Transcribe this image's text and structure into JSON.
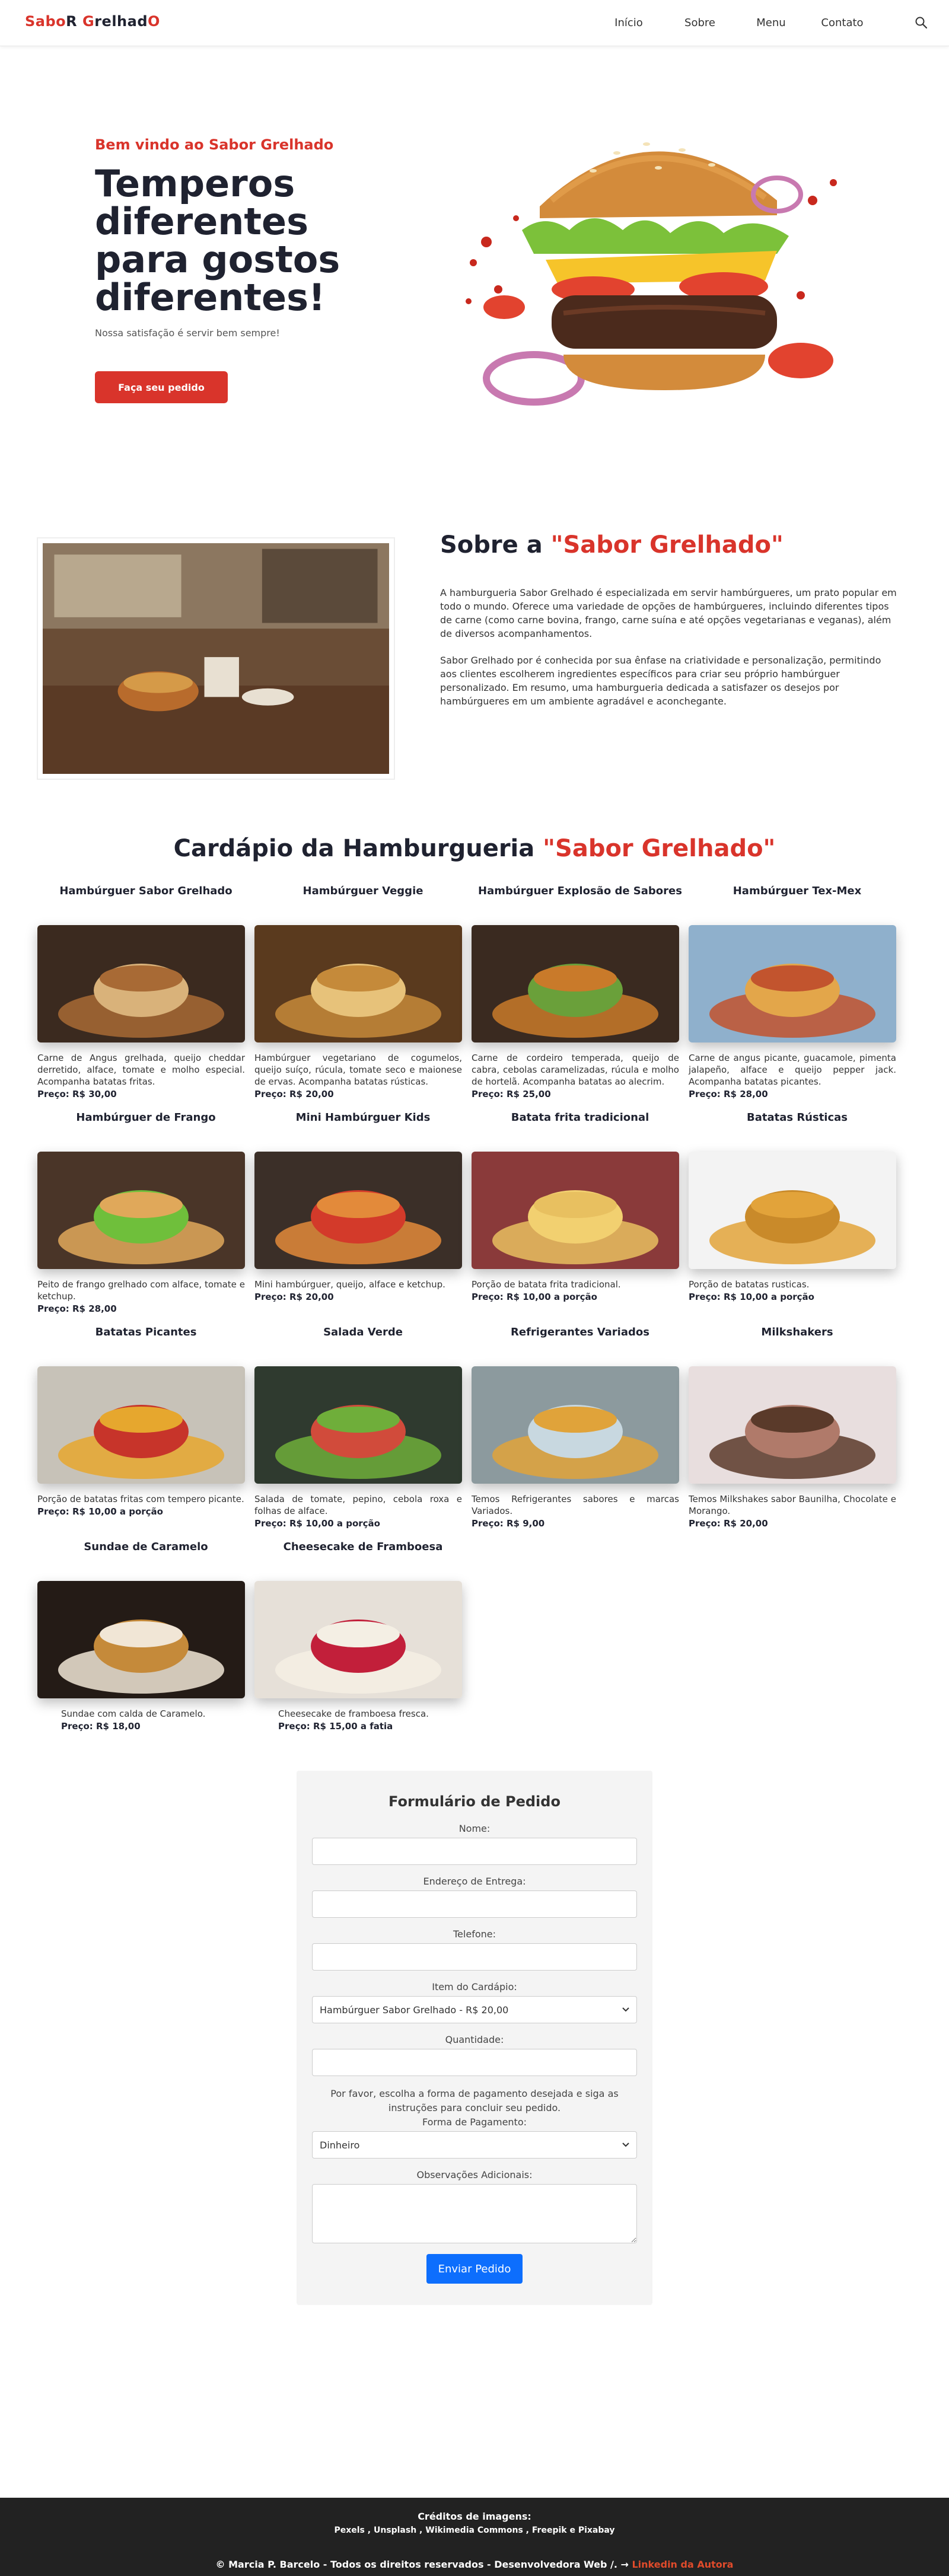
{
  "nav": {
    "logo_red1": "Sabo",
    "logo_dark1": "R ",
    "logo_red2": "G",
    "logo_dark2": "relhad",
    "logo_red3": "O",
    "links": [
      "Início",
      "Sobre",
      "Menu",
      "Contato"
    ],
    "search_icon": "search-icon"
  },
  "hero": {
    "kicker": "Bem vindo ao Sabor Grelhado",
    "title": "Temperos diferentes para gostos diferentes!",
    "subtitle": "Nossa satisfação é servir bem sempre!",
    "button": "Faça seu pedido"
  },
  "sobre": {
    "title_prefix": "Sobre a ",
    "title_highlight": "\"Sabor Grelhado\"",
    "p1": "A hamburgueria Sabor Grelhado é especializada em servir hambúrgueres, um prato popular em todo o mundo. Oferece uma variedade de opções de hambúrgueres, incluindo diferentes tipos de carne (como carne bovina, frango, carne suína e até opções vegetarianas e veganas), além de diversos acompanhamentos.",
    "p2": "Sabor Grelhado por é conhecida por sua ênfase na criatividade e personalização, permitindo aos clientes escolherem ingredientes específicos para criar seu próprio hambúrguer personalizado. Em resumo, uma hamburgueria dedicada a satisfazer os desejos por hambúrgueres em um ambiente agradável e aconchegante."
  },
  "menu": {
    "title_prefix": "Cardápio da Hamburgueria ",
    "title_highlight": "\"Sabor Grelhado\"",
    "price_label": "Preço:",
    "items": [
      {
        "name": "Hambúrguer Sabor Grelhado",
        "desc": "Carne de Angus grelhada, queijo cheddar derretido, alface, tomate e molho especial. Acompanha batatas fritas.",
        "price": "R$ 30,00"
      },
      {
        "name": "Hambúrguer Veggie",
        "desc": "Hambúrguer vegetariano de cogumelos, queijo suíço, rúcula, tomate seco e maionese de ervas. Acompanha batatas rústicas.",
        "price": "R$ 20,00"
      },
      {
        "name": "Hambúrguer Explosão de Sabores",
        "desc": "Carne de cordeiro temperada, queijo de cabra, cebolas caramelizadas, rúcula e molho de hortelã. Acompanha batatas ao alecrim.",
        "price": "R$ 25,00"
      },
      {
        "name": "Hambúrguer Tex-Mex",
        "desc": "Carne de angus picante, guacamole, pimenta jalapeño, alface e queijo pepper jack. Acompanha batatas picantes.",
        "price": "R$ 28,00"
      },
      {
        "name": "Hambúrguer de Frango",
        "desc": "Peito de frango grelhado com alface, tomate e ketchup.",
        "price": "R$ 28,00"
      },
      {
        "name": "Mini Hambúrguer Kids",
        "desc": "Mini hambúrguer, queijo, alface e ketchup.",
        "price": "R$ 20,00"
      },
      {
        "name": "Batata frita tradicional",
        "desc": "Porção de batata frita tradicional.",
        "price": "R$ 10,00 a porção"
      },
      {
        "name": "Batatas Rústicas",
        "desc": "Porção de batatas rusticas.",
        "price": "R$ 10,00 a porção"
      },
      {
        "name": "Batatas Picantes",
        "desc": "Porção de batatas fritas com tempero picante.",
        "price": "R$ 10,00 a porção"
      },
      {
        "name": "Salada Verde",
        "desc": "Salada de tomate, pepino, cebola roxa e folhas de alface.",
        "price": "R$ 10,00 a porção"
      },
      {
        "name": "Refrigerantes Variados",
        "desc": "Temos Refrigerantes sabores e marcas Variados.",
        "price": "R$ 9,00"
      },
      {
        "name": "Milkshakers",
        "desc": "Temos Milkshakes sabor Baunilha, Chocolate e Morango.",
        "price": "R$ 20,00"
      },
      {
        "name": "Sundae de Caramelo",
        "desc": "Sundae com calda de Caramelo.",
        "price": "R$ 18,00"
      },
      {
        "name": "Cheesecake de Framboesa",
        "desc": "Cheesecake de framboesa fresca.",
        "price": "R$ 15,00 a fatia"
      }
    ]
  },
  "form": {
    "title": "Formulário de Pedido",
    "label_name": "Nome:",
    "label_address": "Endereço de Entrega:",
    "label_phone": "Telefone:",
    "label_item": "Item do Cardápio:",
    "item_selected": "Hambúrguer Sabor Grelhado - R$ 20,00",
    "label_qty": "Quantidade:",
    "note": "Por favor, escolha a forma de pagamento desejada e siga as instruções para concluir seu pedido.",
    "label_payment": "Forma de Pagamento:",
    "payment_selected": "Dinheiro",
    "label_obs": "Observações Adicionais:",
    "submit": "Enviar Pedido"
  },
  "footer": {
    "credits_title": "Créditos de imagens:",
    "credits_list": "Pexels , Unsplash , Wikimedia Commons , Freepik e Pixabay",
    "copyright": "© Marcia P. Barcelo - Todos os direitos reservados - Desenvolvedora Web /. →",
    "linkedin": "Linkedin da Autora"
  },
  "colors": {
    "accent": "#d9342b",
    "dark": "#1f2230",
    "button_blue": "#0d6efd",
    "footer_bg": "#222222"
  }
}
